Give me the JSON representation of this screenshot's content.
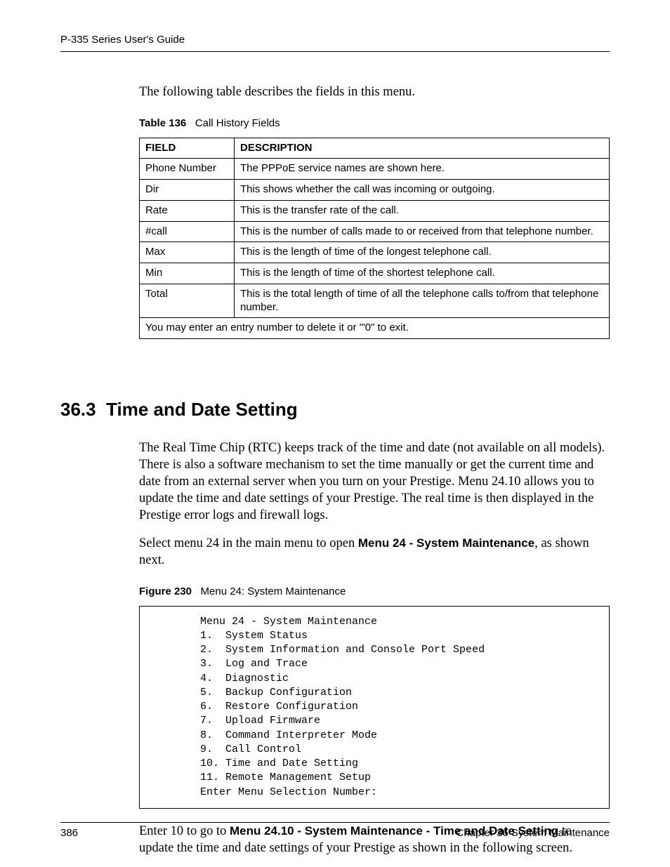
{
  "header": {
    "guide_title": "P-335 Series User's Guide"
  },
  "intro": {
    "text": "The following table describes the fields in this menu."
  },
  "table136": {
    "caption_label": "Table 136",
    "caption_text": "Call History Fields",
    "col_field": "FIELD",
    "col_desc": "DESCRIPTION",
    "rows": [
      {
        "field": "Phone Number",
        "desc": "The PPPoE service names are shown here."
      },
      {
        "field": "Dir",
        "desc": "This shows whether the call was incoming or outgoing."
      },
      {
        "field": "Rate",
        "desc": "This is the transfer rate of the call."
      },
      {
        "field": "#call",
        "desc": "This is the number of calls made to or received from that telephone number."
      },
      {
        "field": "Max",
        "desc": "This is the length of time of the longest telephone call."
      },
      {
        "field": "Min",
        "desc": "This is the length of time of the shortest telephone call."
      },
      {
        "field": "Total",
        "desc": "This is the total length of time of all the telephone calls to/from that telephone number."
      }
    ],
    "footer": "You may enter an entry number to delete it or '\"0\" to exit."
  },
  "section": {
    "number": "36.3",
    "title": "Time and Date Setting",
    "para1": " The Real Time Chip (RTC) keeps track of the time and date (not available on all models). There is also a software mechanism to set the time manually or get the current time and date from an external server when you turn on your Prestige. Menu 24.10 allows you to update the time and date settings of your Prestige. The real time is then displayed in the Prestige error logs and firewall logs.",
    "para2_pre": "Select menu 24 in the main menu to open ",
    "para2_bold": "Menu 24 - System Maintenance",
    "para2_post": ", as shown next."
  },
  "figure230": {
    "caption_label": "Figure 230",
    "caption_text": "Menu 24: System Maintenance",
    "lines": [
      "Menu 24 - System Maintenance",
      "1.  System Status",
      "2.  System Information and Console Port Speed",
      "3.  Log and Trace",
      "4.  Diagnostic",
      "5.  Backup Configuration",
      "6.  Restore Configuration",
      "7.  Upload Firmware",
      "8.  Command Interpreter Mode",
      "9.  Call Control",
      "10. Time and Date Setting",
      "11. Remote Management Setup",
      "Enter Menu Selection Number:"
    ]
  },
  "closing": {
    "pre": "Enter 10 to go to ",
    "bold": "Menu 24.10 - System Maintenance - Time and Date Setting",
    "post": " to update the time and date settings of your Prestige as shown in the following screen."
  },
  "footer": {
    "page_number": "386",
    "chapter": "Chapter 36 System Maintenance"
  }
}
